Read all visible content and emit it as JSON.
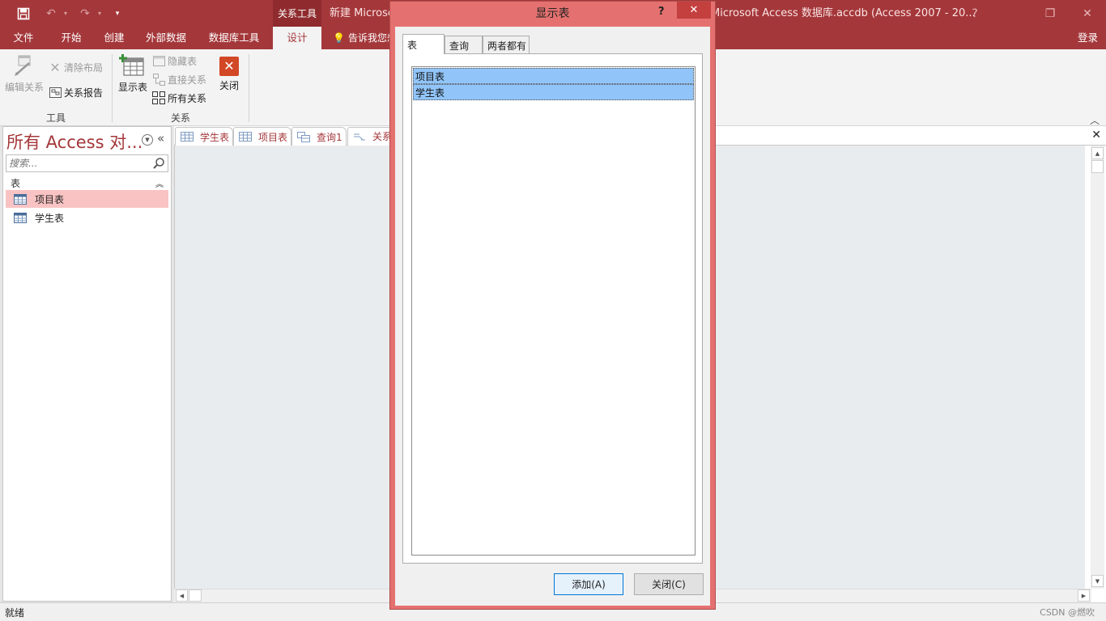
{
  "titlebar": {
    "context_tab_title": "关系工具",
    "title_left": "新建 Microsc",
    "title_right": "Microsoft Access 数据库.accdb (Access 2007 - 20...",
    "help": "?",
    "restore": "❐",
    "close": "✕"
  },
  "ribbon_tabs": {
    "file": "文件",
    "home": "开始",
    "create": "创建",
    "external": "外部数据",
    "dbtools": "数据库工具",
    "design": "设计",
    "tell_me": "告诉我您想",
    "login": "登录"
  },
  "ribbon": {
    "edit_relationships": "编辑关系",
    "clear_layout": "清除布局",
    "relationship_report": "关系报告",
    "group_tools": "工具",
    "show_table": "显示表",
    "hide_table": "隐藏表",
    "direct_relationships": "直接关系",
    "all_relationships": "所有关系",
    "close": "关闭",
    "group_relationships": "关系"
  },
  "nav": {
    "title": "所有 Access 对...",
    "search_placeholder": "搜索...",
    "group": "表",
    "items": [
      {
        "label": "项目表",
        "selected": true
      },
      {
        "label": "学生表",
        "selected": false
      }
    ]
  },
  "doc_tabs": [
    "学生表",
    "项目表",
    "查询1",
    "关系"
  ],
  "status": {
    "text": "就绪",
    "watermark": "CSDN @燃吹"
  },
  "dialog": {
    "title": "显示表",
    "help": "?",
    "close": "✕",
    "tabs": [
      "表",
      "查询",
      "两者都有"
    ],
    "active_tab": "表",
    "list_items": [
      "项目表",
      "学生表"
    ],
    "add_button": "添加(A)",
    "close_button": "关闭(C)"
  },
  "colors": {
    "accent": "#a4373a",
    "dialog_frame": "#e4716f",
    "selection": "#91c5f9",
    "nav_selected": "#f9c3c4"
  }
}
